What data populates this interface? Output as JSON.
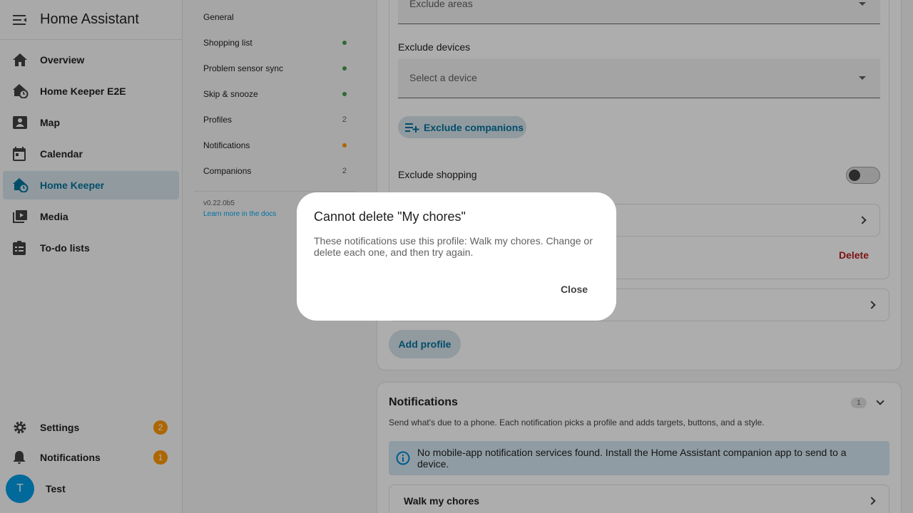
{
  "sidebar": {
    "app_title": "Home Assistant",
    "items": [
      {
        "label": "Overview",
        "icon": "home-icon"
      },
      {
        "label": "Home Keeper E2E",
        "icon": "home-clock-icon"
      },
      {
        "label": "Map",
        "icon": "map-person-icon"
      },
      {
        "label": "Calendar",
        "icon": "calendar-icon"
      },
      {
        "label": "Home Keeper",
        "icon": "home-clock-icon",
        "active": true
      },
      {
        "label": "Media",
        "icon": "media-icon"
      },
      {
        "label": "To-do lists",
        "icon": "clipboard-list-icon"
      }
    ],
    "bottom": {
      "settings_label": "Settings",
      "settings_badge": "2",
      "notifications_label": "Notifications",
      "notifications_badge": "1",
      "user_initial": "T",
      "user_name": "Test"
    },
    "active_color": "#03729c"
  },
  "subnav": {
    "items": [
      {
        "label": "General"
      },
      {
        "label": "Shopping list",
        "dot": "#43a047"
      },
      {
        "label": "Problem sensor sync",
        "dot": "#43a047"
      },
      {
        "label": "Skip & snooze",
        "dot": "#43a047"
      },
      {
        "label": "Profiles",
        "count": "2"
      },
      {
        "label": "Notifications",
        "dot": "#ff9800"
      },
      {
        "label": "Companions",
        "count": "2"
      }
    ],
    "version": "v0.22.0b5",
    "docs_link": "Learn more in the docs"
  },
  "profile_editor": {
    "exclude_areas_placeholder": "Exclude areas",
    "exclude_devices_label": "Exclude devices",
    "exclude_devices_placeholder": "Select a device",
    "exclude_companions_label": "Exclude companions",
    "exclude_shopping_label": "Exclude shopping",
    "exclude_shopping_on": false,
    "delete_label": "Delete",
    "add_profile_label": "Add profile"
  },
  "notifications_section": {
    "title": "Notifications",
    "count": "1",
    "description": "Send what's due to a phone. Each notification picks a profile and adds targets, buttons, and a style.",
    "info_text": "No mobile-app notification services found. Install the Home Assistant companion app to send to a device.",
    "items": [
      {
        "label": "Walk my chores"
      }
    ]
  },
  "dialog": {
    "title": "Cannot delete \"My chores\"",
    "body": "These notifications use this profile: Walk my chores. Change or delete each one, and then try again.",
    "close_label": "Close"
  }
}
